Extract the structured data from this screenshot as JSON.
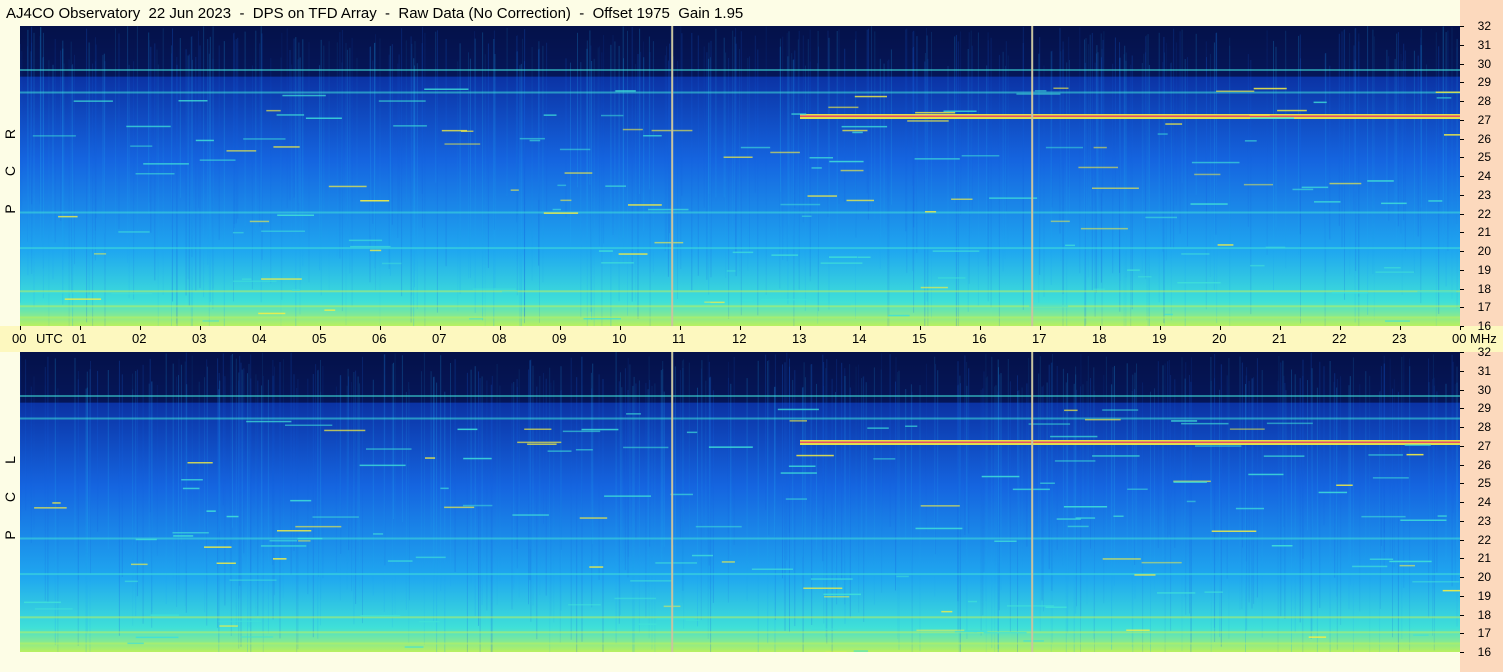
{
  "title": "AJ4CO Observatory  22 Jun 2023  -  DPS on TFD Array  -  Raw Data (No Correction)  -  Offset 1975  Gain 1.95",
  "chart_data": {
    "type": "heatmap",
    "title": "AJ4CO Observatory  22 Jun 2023  -  DPS on TFD Array  -  Raw Data (No Correction)  -  Offset 1975  Gain 1.95",
    "x_unit_label": "UTC",
    "y_unit_label": "MHz",
    "x_ticks": [
      "00",
      "01",
      "02",
      "03",
      "04",
      "05",
      "06",
      "07",
      "08",
      "09",
      "10",
      "11",
      "12",
      "13",
      "14",
      "15",
      "16",
      "17",
      "18",
      "19",
      "20",
      "21",
      "22",
      "23",
      "00"
    ],
    "x_range_hours": [
      0,
      24
    ],
    "y_ticks": [
      "32",
      "31",
      "30",
      "29",
      "28",
      "27",
      "26",
      "25",
      "24",
      "23",
      "22",
      "21",
      "20",
      "19",
      "18",
      "17",
      "16"
    ],
    "y_range_mhz": [
      16,
      32
    ],
    "panels": [
      {
        "name": "top",
        "polarization": [
          "R",
          "C",
          "P"
        ]
      },
      {
        "name": "bottom",
        "polarization": [
          "L",
          "C",
          "P"
        ]
      }
    ],
    "vertical_markers_utc": [
      10.87,
      16.87
    ],
    "bright_bands_mhz": [
      27.2,
      29.6,
      28.4,
      20.1,
      22.0,
      17.8,
      17.0,
      16.4
    ],
    "colormap": [
      "#05124a",
      "#0a2fa0",
      "#1565e0",
      "#1fa7f0",
      "#3fe0d8",
      "#b8f060",
      "#f8f040",
      "#f08050",
      "#e81070"
    ]
  }
}
